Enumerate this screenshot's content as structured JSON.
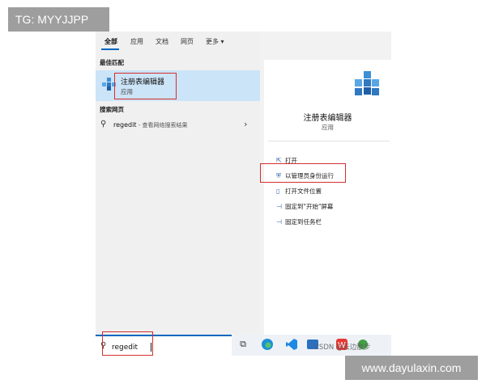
{
  "watermarks": {
    "top_left": "TG: MYYJJPP",
    "bottom_right": "www.dayulaxin.com"
  },
  "tabs": [
    {
      "label": "全部",
      "active": true
    },
    {
      "label": "应用"
    },
    {
      "label": "文档"
    },
    {
      "label": "网页"
    },
    {
      "label": "更多 ▾"
    }
  ],
  "best_match": {
    "heading": "最佳匹配",
    "title": "注册表编辑器",
    "subtitle": "应用",
    "icon": "registry-editor-icon"
  },
  "web_search": {
    "heading": "搜索网页",
    "keyword": "regedit",
    "suffix": " - 查看网络搜索结果",
    "chevron": "›"
  },
  "detail": {
    "title": "注册表编辑器",
    "subtitle": "应用"
  },
  "actions": [
    {
      "label": "打开",
      "icon": "open-icon",
      "glyph": "⇱"
    },
    {
      "label": "以管理员身份运行",
      "icon": "run-as-admin-icon",
      "glyph": "⛨"
    },
    {
      "label": "打开文件位置",
      "icon": "folder-location-icon",
      "glyph": "▯"
    },
    {
      "label": "固定到\"开始\"屏幕",
      "icon": "pin-icon",
      "glyph": "⊣"
    },
    {
      "label": "固定到任务栏",
      "icon": "pin-taskbar-icon",
      "glyph": "⊣"
    }
  ],
  "search": {
    "value": "regedit",
    "icon": "search-icon"
  },
  "taskbar": {
    "overlay_text": "CSDN @云边散步"
  },
  "colors": {
    "accent": "#0067c0",
    "highlight": "#cce4f7",
    "annotation": "#d32f2f"
  }
}
